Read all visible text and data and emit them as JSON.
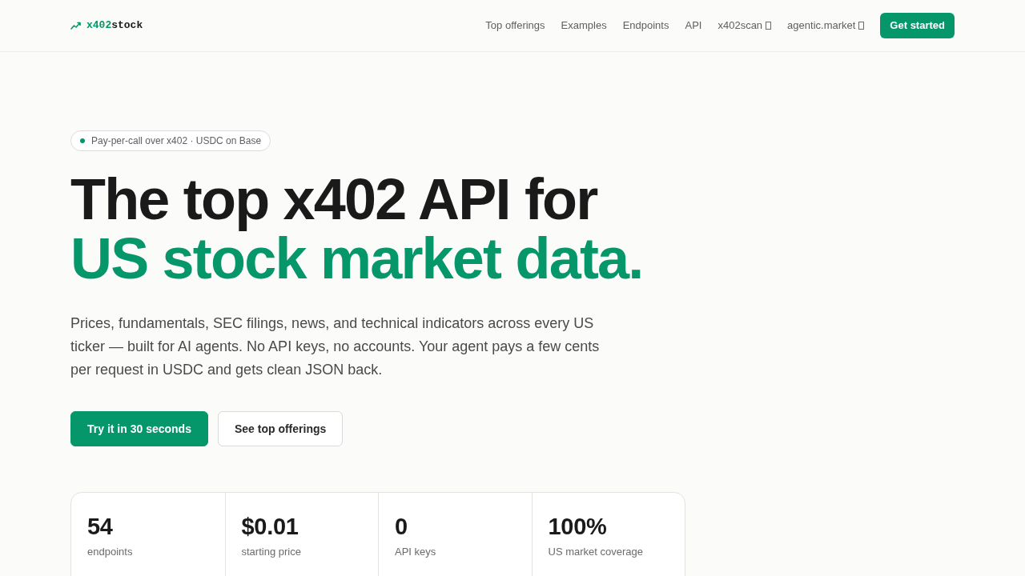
{
  "header": {
    "logo": {
      "accent": "x402",
      "rest": "stock"
    },
    "nav": [
      {
        "label": "Top offerings",
        "external": false
      },
      {
        "label": "Examples",
        "external": false
      },
      {
        "label": "Endpoints",
        "external": false
      },
      {
        "label": "API",
        "external": false
      },
      {
        "label": "x402scan",
        "external": true
      },
      {
        "label": "agentic.market",
        "external": true
      }
    ],
    "cta": "Get started"
  },
  "hero": {
    "badge": "Pay-per-call over x402 · USDC on Base",
    "title_line_1": "The top x402 API for",
    "title_line_2": "US stock market data.",
    "description": "Prices, fundamentals, SEC filings, news, and technical indicators across every US ticker — built for AI agents. No API keys, no accounts. Your agent pays a few cents per request in USDC and gets clean JSON back.",
    "buttons": [
      {
        "label": "Try it in 30 seconds",
        "kind": "primary"
      },
      {
        "label": "See top offerings",
        "kind": "secondary"
      }
    ]
  },
  "stats": [
    {
      "value": "54",
      "label": "endpoints"
    },
    {
      "value": "$0.01",
      "label": "starting price"
    },
    {
      "value": "0",
      "label": "API keys"
    },
    {
      "value": "100%",
      "label": "US market coverage"
    }
  ]
}
